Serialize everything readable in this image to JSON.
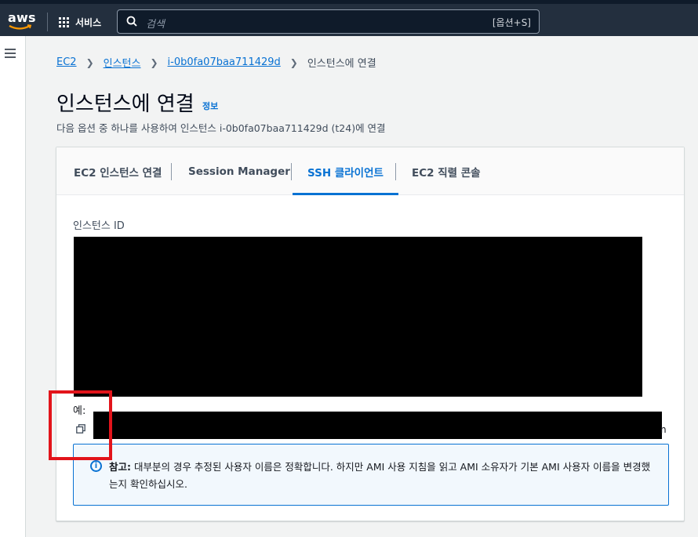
{
  "topnav": {
    "logo_text": "aws",
    "services_label": "서비스",
    "search_placeholder": "검색",
    "search_shortcut": "[옵션+S]"
  },
  "breadcrumb": {
    "items": [
      "EC2",
      "인스턴스",
      "i-0b0fa07baa711429d",
      "인스턴스에 연결"
    ]
  },
  "page": {
    "title": "인스턴스에 연결",
    "info_link": "정보",
    "subtitle": "다음 옵션 중 하나를 사용하여 인스턴스 i-0b0fa07baa711429d (t24)에 연결"
  },
  "tabs": [
    {
      "label": "EC2 인스턴스 연결",
      "active": false
    },
    {
      "label": "Session Manager",
      "active": false
    },
    {
      "label": "SSH 클라이언트",
      "active": true
    },
    {
      "label": "EC2 직렬 콘솔",
      "active": false
    }
  ],
  "content": {
    "instance_id_label": "인스턴스 ID",
    "example_label": "예:",
    "command_trailing": "n"
  },
  "infobox": {
    "prefix": "참고:",
    "text": " 대부분의 경우 추정된 사용자 이름은 정확합니다. 하지만 AMI 사용 지침을 읽고 AMI 소유자가 기본 AMI 사용자 이름을 변경했는지 확인하십시오."
  },
  "colors": {
    "nav_bg": "#232f3e",
    "link": "#0972d3",
    "highlight_border": "#e2141b"
  }
}
